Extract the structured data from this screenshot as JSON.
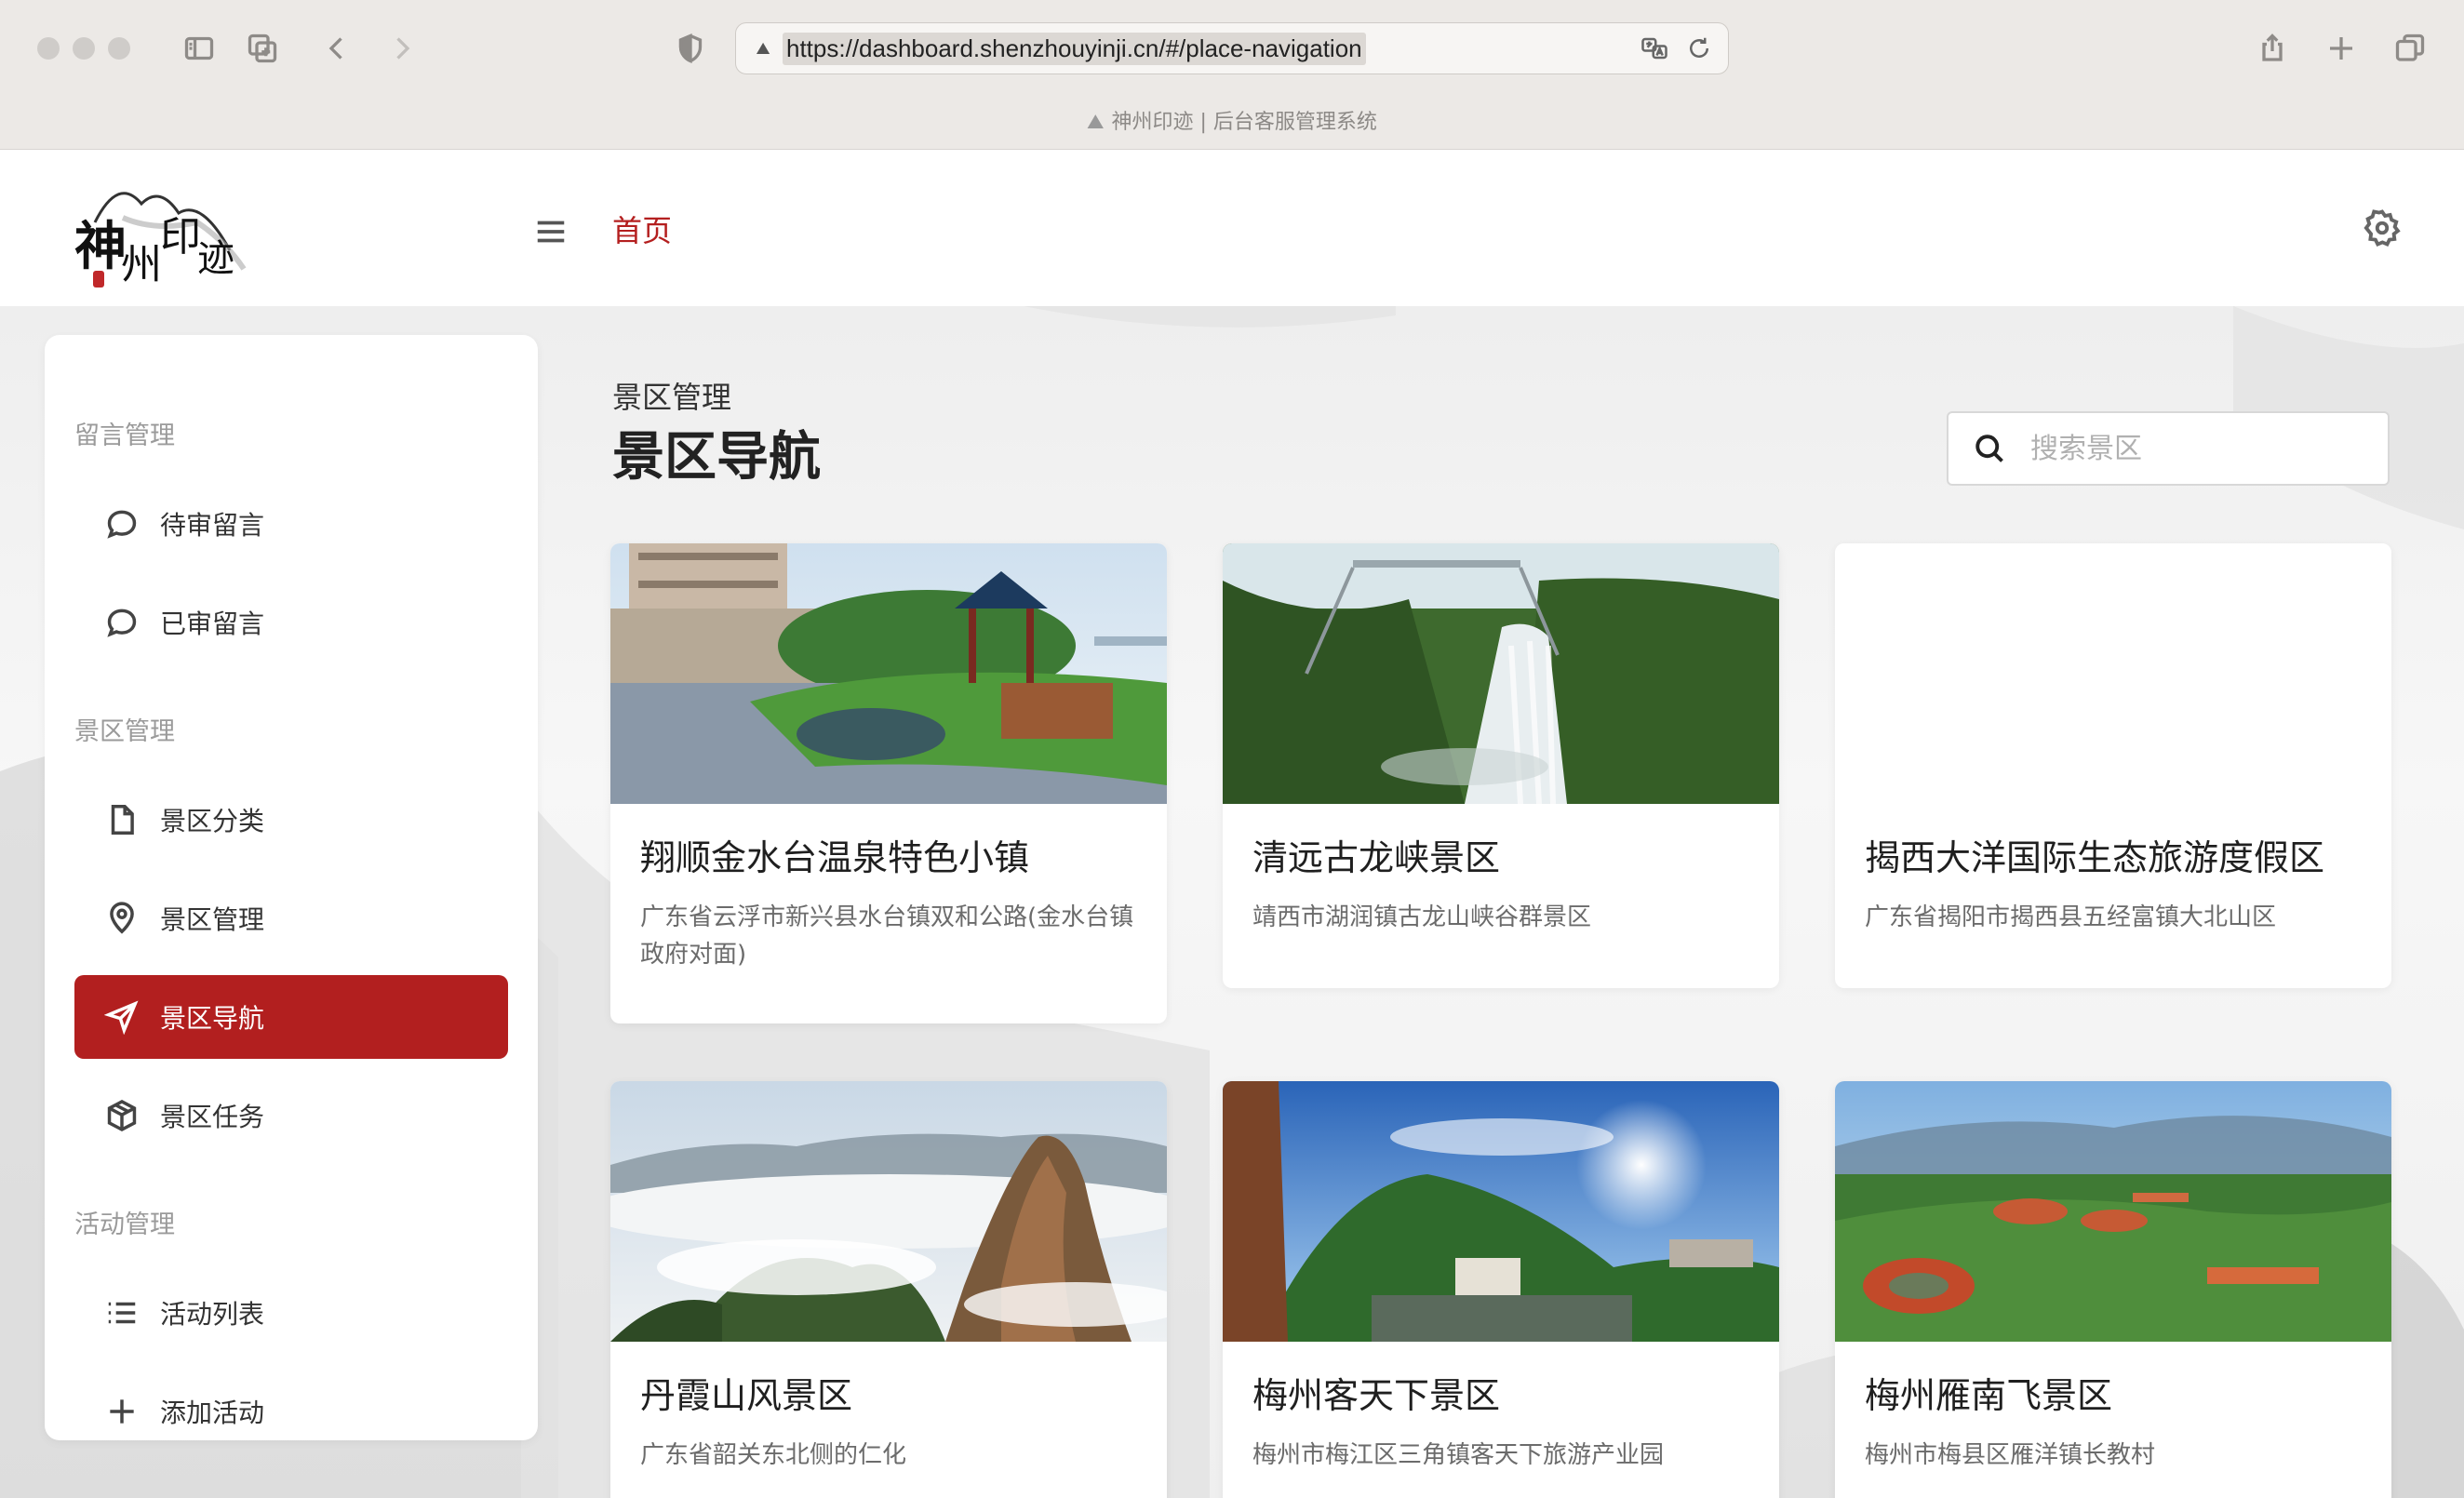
{
  "browser": {
    "url": "https://dashboard.shenzhouyinji.cn/#/place-navigation",
    "tab_title": "神州印迹 | 后台客服管理系统"
  },
  "header": {
    "breadcrumb_home": "首页"
  },
  "sidebar": {
    "groups": [
      {
        "label": "留言管理",
        "items": [
          {
            "label": "待审留言",
            "icon": "chat-icon"
          },
          {
            "label": "已审留言",
            "icon": "chat-icon"
          }
        ]
      },
      {
        "label": "景区管理",
        "items": [
          {
            "label": "景区分类",
            "icon": "document-icon"
          },
          {
            "label": "景区管理",
            "icon": "location-pin-icon"
          },
          {
            "label": "景区导航",
            "icon": "navigation-icon",
            "active": true
          },
          {
            "label": "景区任务",
            "icon": "box-icon"
          }
        ]
      },
      {
        "label": "活动管理",
        "items": [
          {
            "label": "活动列表",
            "icon": "list-icon"
          },
          {
            "label": "添加活动",
            "icon": "plus-icon"
          }
        ]
      }
    ]
  },
  "main": {
    "subtitle": "景区管理",
    "title": "景区导航",
    "search_placeholder": "搜索景区",
    "cards": [
      {
        "title": "翔顺金水台温泉特色小镇",
        "address": "广东省云浮市新兴县水台镇双和公路(金水台镇政府对面)"
      },
      {
        "title": "清远古龙峡景区",
        "address": "靖西市湖润镇古龙山峡谷群景区"
      },
      {
        "title": "揭西大洋国际生态旅游度假区",
        "address": "广东省揭阳市揭西县五经富镇大北山区"
      },
      {
        "title": "丹霞山风景区",
        "address": "广东省韶关东北侧的仁化"
      },
      {
        "title": "梅州客天下景区",
        "address": "梅州市梅江区三角镇客天下旅游产业园"
      },
      {
        "title": "梅州雁南飞景区",
        "address": "梅州市梅县区雁洋镇长教村"
      }
    ]
  },
  "colors": {
    "accent": "#b21f1f",
    "chrome": "#ece9e6"
  }
}
